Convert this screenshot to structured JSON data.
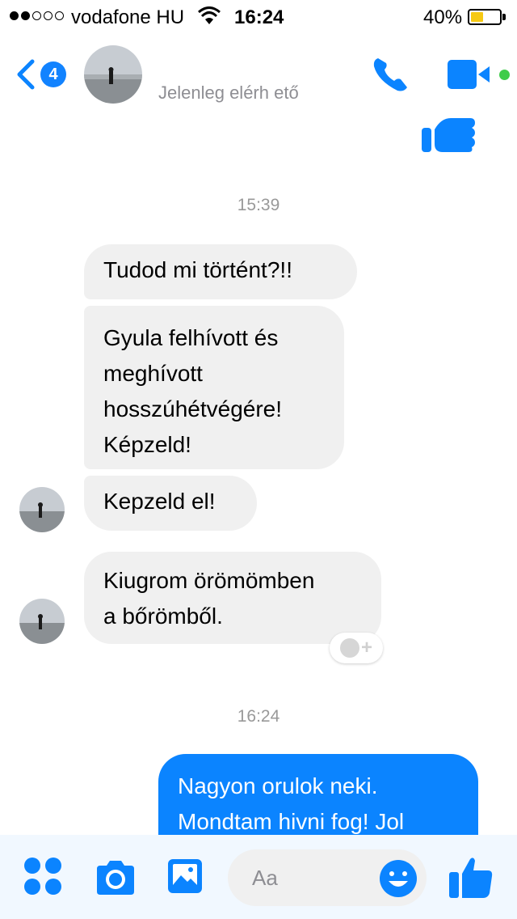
{
  "status_bar": {
    "carrier": "vodafone HU",
    "time": "16:24",
    "battery": "40%",
    "battery_level": 0.4,
    "signal_bars_filled": 2,
    "signal_bars_total": 5
  },
  "header": {
    "back_badge": "4",
    "contact_name": "",
    "presence": "Jelenleg elérh  ető",
    "accent_color": "#0b84ff",
    "online_color": "#3fcc4a"
  },
  "conversation": {
    "timestamp_1": "15:39",
    "incoming": [
      "Tudod mi történt?!!",
      "Gyula felhívott és\nmeghívott\nhosszúhétvégére!\nKépzeld!",
      "Kepzeld el!",
      "Kiugrom örömömben\na bőrömből."
    ],
    "timestamp_2": "16:24",
    "outgoing": [
      "Nagyon orulok neki.\nMondtam hivni fog! Jol"
    ]
  },
  "composer": {
    "placeholder": "Aa",
    "icons": [
      "apps-icon",
      "camera-icon",
      "gallery-icon",
      "emoji-icon",
      "thumbs-up-icon"
    ]
  }
}
